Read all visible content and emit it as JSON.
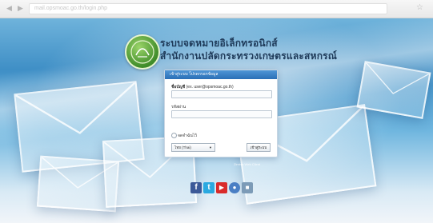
{
  "browser": {
    "back_icon": "back-arrow-icon",
    "forward_icon": "forward-arrow-icon",
    "address": "mail.opsmoac.go.th/login.php",
    "star_icon": "bookmark-star-icon"
  },
  "header": {
    "logo_icon": "ministry-seal-icon",
    "title_line1": "ระบบจดหมายอิเล็กทรอนิกส์",
    "title_line2": "สำนักงานปลัดกระทรวงเกษตรและสหกรณ์"
  },
  "login": {
    "panel_title": "เข้าสู่ระบบ โปรดกรอกข้อมูล",
    "username_label": "ชื่อบัญชี",
    "username_hint": "(ex. user@opsmoac.go.th)",
    "username_value": "",
    "password_label": "รหัสผ่าน",
    "password_value": "",
    "remember_label": "จดจำฉันไว้",
    "language_selected": "ไทย (Thai)",
    "submit_label": "เข้าสู่ระบบ"
  },
  "footer": {
    "note": "Zimbra Web Client",
    "social": [
      {
        "icon": "facebook-icon",
        "glyph": "f",
        "color": "#3b5998"
      },
      {
        "icon": "twitter-icon",
        "glyph": "t",
        "color": "#2aa9e0"
      },
      {
        "icon": "youtube-icon",
        "glyph": "▶",
        "color": "#d92b2b"
      },
      {
        "icon": "messenger-icon",
        "glyph": "●",
        "color": "#4a7fc4"
      },
      {
        "icon": "bookmark-icon",
        "glyph": "■",
        "color": "#7c9bb7"
      }
    ]
  },
  "colors": {
    "accent": "#2a6fb6",
    "title": "#1f3b5a",
    "logo_green": "#3f8c2a"
  }
}
